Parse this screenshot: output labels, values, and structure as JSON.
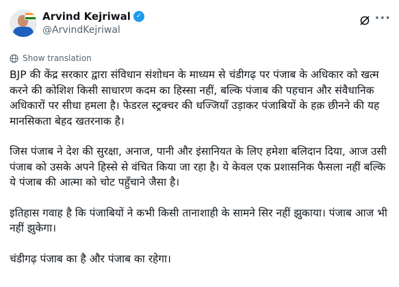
{
  "author": {
    "display_name": "Arvind Kejriwal",
    "handle": "@ArvindKejriwal",
    "verified_badge": "✓"
  },
  "icons": {
    "avatar": "profile-photo",
    "verified": "verified-badge-icon",
    "grok": "grok-icon",
    "more": "more-options-icon",
    "translate": "globe-icon"
  },
  "translate_label": "Show translation",
  "tweet": {
    "paragraphs": [
      "BJP की केंद्र सरकार द्वारा संविधान संशोधन के माध्यम से चंडीगढ़ पर पंजाब के अधिकार को खत्म करने की कोशिश किसी साधारण कदम का हिस्सा नहीं, बल्कि पंजाब की पहचान और संवैधानिक अधिकारों पर सीधा हमला है। फेडरल स्ट्रक्चर की धज्जियाँ उड़ाकर पंजाबियों के हक़ छीनने की यह मानसिकता बेहद खतरनाक है।",
      "जिस पंजाब ने देश की सुरक्षा, अनाज, पानी और इंसानियत के लिए हमेशा बलिदान दिया, आज उसी पंजाब को उसके अपने हिस्से से वंचित किया जा रहा है। ये केवल एक प्रशासनिक फैसला नहीं बल्कि ये पंजाब की आत्मा को चोट पहुँचाने जैसा है।",
      "इतिहास गवाह है कि पंजाबियों ने कभी किसी तानाशाही के सामने सिर नहीं झुकाया। पंजाब आज भी नहीं झुकेगा।",
      "चंडीगढ़ पंजाब का है और पंजाब का रहेगा।"
    ]
  },
  "colors": {
    "verified": "#1d9bf0",
    "secondary_text": "#536471",
    "primary_text": "#0f1419"
  }
}
